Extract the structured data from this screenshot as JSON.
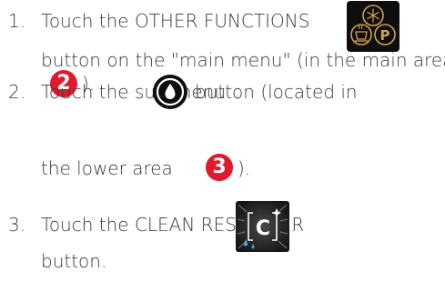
{
  "steps": [
    {
      "number": "1.",
      "line1": "Touch the OTHER FUNCTIONS",
      "line2a": "button on the \"main menu\" (in the main area",
      "line3b": ")."
    },
    {
      "number": "2.",
      "line1a": "Touch the sub-menu",
      "line1b": "button (located in",
      "line2a": "the lower area",
      "line2b": ")."
    },
    {
      "number": "3.",
      "line1": "Touch the CLEAN RESERVOIR",
      "line2": "button."
    }
  ],
  "badges": {
    "main_area": "2",
    "lower_area": "3"
  },
  "icons": {
    "other_functions": "other-functions-icon",
    "water_drop": "water-drop-icon",
    "clean_reservoir": "clean-reservoir-icon"
  },
  "icon_letters": {
    "other_functions": "P",
    "clean_reservoir": "C"
  },
  "colors": {
    "text": "#3a3a3a",
    "badge": "#e0192b",
    "gold": "#d4a24c",
    "icon_bg": "#0e0e0e"
  }
}
